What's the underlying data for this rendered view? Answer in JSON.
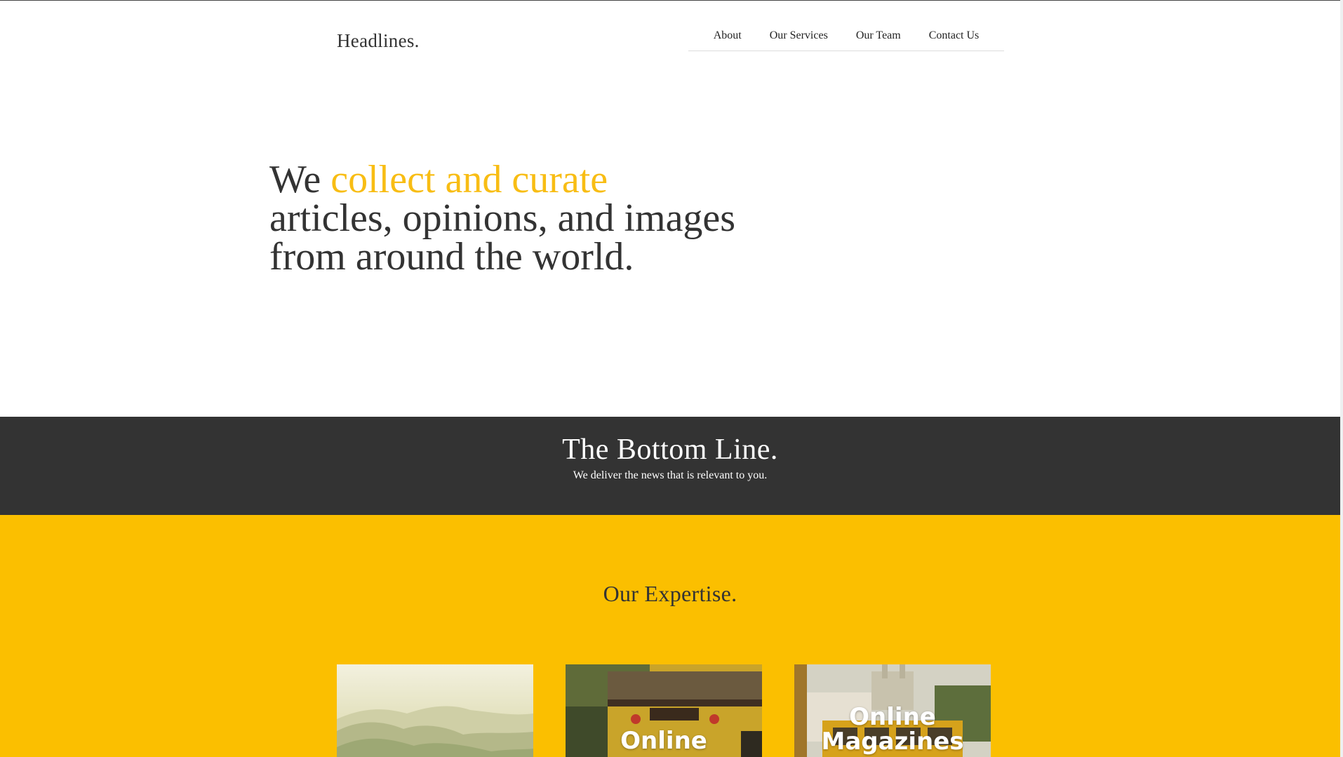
{
  "header": {
    "brand": "Headlines.",
    "nav": [
      "About",
      "Our Services",
      "Our Team",
      "Contact Us"
    ]
  },
  "hero": {
    "line1_prefix": "We ",
    "line1_accent": "collect and curate",
    "line2": "articles, opinions, and images",
    "line3": "from around the world."
  },
  "bottom_line": {
    "title": "The Bottom Line.",
    "subtitle": "We deliver the news that is relevant to you."
  },
  "expertise": {
    "title": "Our Expertise.",
    "cards": [
      {
        "label_line1": "",
        "label_line2": ""
      },
      {
        "label_line1": "Online",
        "label_line2": ""
      },
      {
        "label_line1": "Online",
        "label_line2": "Magazines"
      }
    ]
  },
  "colors": {
    "accent": "#f8bd14",
    "dark": "#333333",
    "yellow_band": "#fbbf00"
  }
}
